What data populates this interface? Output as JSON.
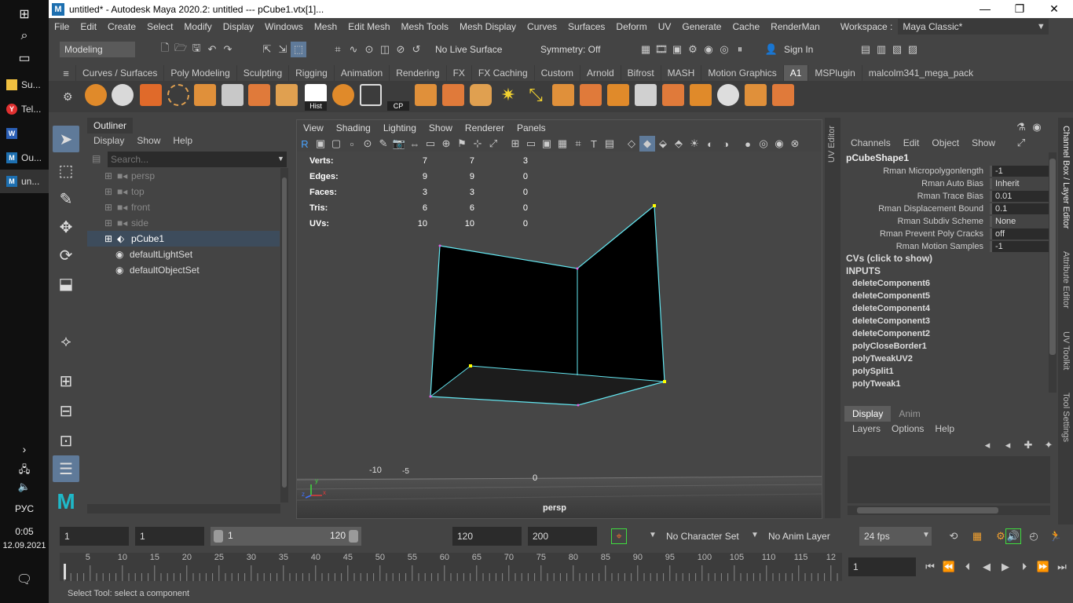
{
  "taskbar": {
    "apps": [
      {
        "label": "Su...",
        "color": "#f0c040"
      },
      {
        "label": "Tel...",
        "color": "#e03030"
      },
      {
        "label": "",
        "color": "#2b5fb5"
      },
      {
        "label": "Ou...",
        "color": "#1d6fb0"
      },
      {
        "label": "un...",
        "color": "#1d6fb0"
      }
    ],
    "lang": "РУС",
    "time": "0:05",
    "date": "12.09.2021"
  },
  "titlebar": {
    "logo": "M",
    "title": "untitled* - Autodesk Maya 2020.2: untitled   ---   pCube1.vtx[1]..."
  },
  "menubar": {
    "items": [
      "File",
      "Edit",
      "Create",
      "Select",
      "Modify",
      "Display",
      "Windows",
      "Mesh",
      "Edit Mesh",
      "Mesh Tools",
      "Mesh Display",
      "Curves",
      "Surfaces",
      "Deform",
      "UV",
      "Generate",
      "Cache",
      "RenderMan"
    ],
    "workspace_label": "Workspace :",
    "workspace_value": "Maya Classic*"
  },
  "statusline": {
    "mode": "Modeling",
    "live_surface": "No Live Surface",
    "symmetry": "Symmetry: Off",
    "sign_in": "Sign In"
  },
  "shelf": {
    "tabs": [
      "Curves / Surfaces",
      "Poly Modeling",
      "Sculpting",
      "Rigging",
      "Animation",
      "Rendering",
      "FX",
      "FX Caching",
      "Custom",
      "Arnold",
      "Bifrost",
      "MASH",
      "Motion Graphics",
      "A1",
      "MSPlugin",
      "malcolm341_mega_pack"
    ],
    "active_tab": "A1",
    "hist_label": "Hist",
    "cp_label": "CP"
  },
  "outliner": {
    "title": "Outliner",
    "menu": [
      "Display",
      "Show",
      "Help"
    ],
    "search_placeholder": "Search...",
    "items": [
      {
        "label": "persp",
        "dim": true
      },
      {
        "label": "top",
        "dim": true
      },
      {
        "label": "front",
        "dim": true
      },
      {
        "label": "side",
        "dim": true
      },
      {
        "label": "pCube1",
        "dim": false,
        "selected": true
      },
      {
        "label": "defaultLightSet",
        "dim": false
      },
      {
        "label": "defaultObjectSet",
        "dim": false
      }
    ]
  },
  "viewport": {
    "menu": [
      "View",
      "Shading",
      "Lighting",
      "Show",
      "Renderer",
      "Panels"
    ],
    "hud": {
      "rows": [
        {
          "label": "Verts:",
          "a": "7",
          "b": "7",
          "c": "3"
        },
        {
          "label": "Edges:",
          "a": "9",
          "b": "9",
          "c": "0"
        },
        {
          "label": "Faces:",
          "a": "3",
          "b": "3",
          "c": "0"
        },
        {
          "label": "Tris:",
          "a": "6",
          "b": "6",
          "c": "0"
        },
        {
          "label": "UVs:",
          "a": "10",
          "b": "10",
          "c": "0"
        }
      ]
    },
    "grid_labels": [
      "-10",
      "-5",
      "0"
    ],
    "camera": "persp",
    "axis_x": "x",
    "axis_y": "y",
    "axis_z": "z"
  },
  "channelbox": {
    "menu": [
      "Channels",
      "Edit",
      "Object",
      "Show"
    ],
    "object": "pCubeShape1",
    "attributes": [
      {
        "name": "Rman Micropolygonlength",
        "value": "-1"
      },
      {
        "name": "Rman Auto Bias",
        "value": "Inherit"
      },
      {
        "name": "Rman Trace Bias",
        "value": "0.01"
      },
      {
        "name": "Rman Displacement Bound",
        "value": "0.1"
      },
      {
        "name": "Rman Subdiv Scheme",
        "value": "None"
      },
      {
        "name": "Rman Prevent Poly Cracks",
        "value": "off"
      },
      {
        "name": "Rman Motion Samples",
        "value": "-1"
      }
    ],
    "cvs_label": "CVs (click to show)",
    "inputs_label": "INPUTS",
    "inputs": [
      "deleteComponent6",
      "deleteComponent5",
      "deleteComponent4",
      "deleteComponent3",
      "deleteComponent2",
      "polyCloseBorder1",
      "polyTweakUV2",
      "polySplit1",
      "polyTweak1"
    ]
  },
  "side_tabs_left": [
    "UV Editor"
  ],
  "side_tabs_right": [
    "Channel Box / Layer Editor",
    "Attribute Editor",
    "UV Toolkit",
    "Tool Settings"
  ],
  "layereditor": {
    "tabs": [
      "Display",
      "Anim"
    ],
    "menu": [
      "Layers",
      "Options",
      "Help"
    ]
  },
  "timeline": {
    "start": "1",
    "range_start": "1",
    "slider_start": "1",
    "slider_end": "120",
    "range_end": "120",
    "end": "200",
    "char_set": "No Character Set",
    "anim_layer": "No Anim Layer",
    "fps": "24 fps",
    "ticks": [
      "5",
      "10",
      "15",
      "20",
      "25",
      "30",
      "35",
      "40",
      "45",
      "50",
      "55",
      "60",
      "65",
      "70",
      "75",
      "80",
      "85",
      "90",
      "95",
      "100",
      "105",
      "110",
      "115",
      "12"
    ],
    "current_frame": "1"
  },
  "helpline": {
    "text": "Select Tool: select a component"
  }
}
